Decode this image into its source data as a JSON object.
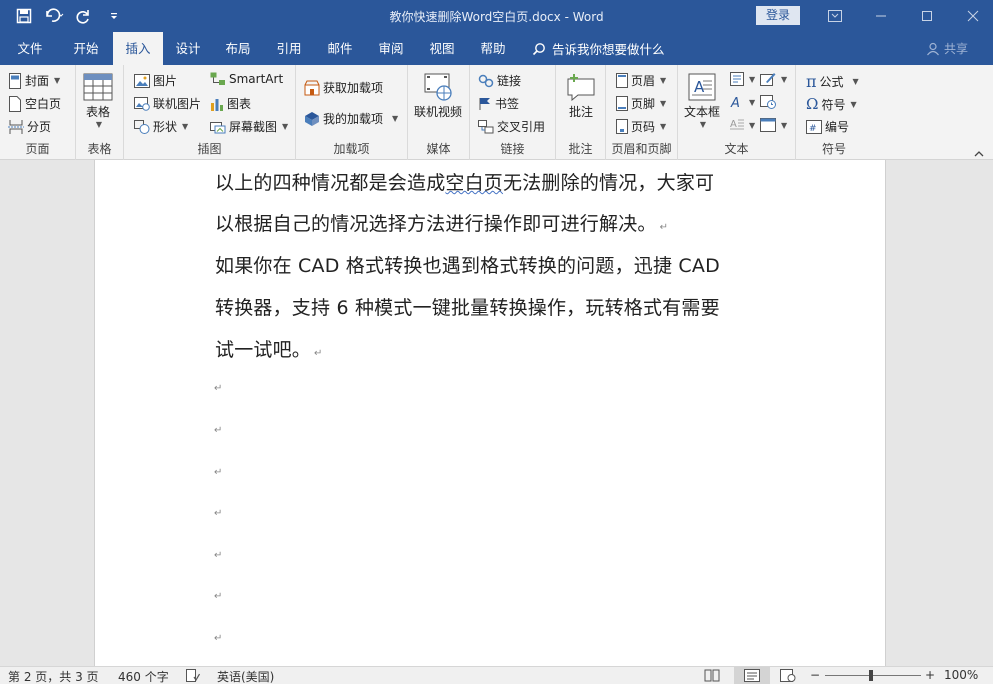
{
  "window": {
    "title": "教你快速删除Word空白页.docx  -  Word",
    "login_label": "登录"
  },
  "tabs": [
    {
      "label": "文件"
    },
    {
      "label": "开始"
    },
    {
      "label": "插入",
      "active": true
    },
    {
      "label": "设计"
    },
    {
      "label": "布局"
    },
    {
      "label": "引用"
    },
    {
      "label": "邮件"
    },
    {
      "label": "审阅"
    },
    {
      "label": "视图"
    },
    {
      "label": "帮助"
    }
  ],
  "tell_me": "告诉我你想要做什么",
  "account_label": "共享",
  "ribbon": {
    "pages": {
      "label": "页面",
      "cover": "封面",
      "blank": "空白页",
      "break": "分页"
    },
    "tables": {
      "label": "表格",
      "table": "表格"
    },
    "illustrations": {
      "label": "插图",
      "pictures": "图片",
      "online_pictures": "联机图片",
      "shapes": "形状",
      "smartart": "SmartArt",
      "chart": "图表",
      "screenshot": "屏幕截图"
    },
    "addins": {
      "label": "加载项",
      "get": "获取加载项",
      "my": "我的加载项"
    },
    "media": {
      "label": "媒体",
      "online_video": "联机视频"
    },
    "links": {
      "label": "链接",
      "link": "链接",
      "bookmark": "书签",
      "cross_ref": "交叉引用"
    },
    "comments": {
      "label": "批注",
      "comment": "批注"
    },
    "header_footer": {
      "label": "页眉和页脚",
      "header": "页眉",
      "footer": "页脚",
      "page_number": "页码"
    },
    "text": {
      "label": "文本",
      "textbox": "文本框"
    },
    "symbols": {
      "label": "符号",
      "equation": "公式",
      "symbol": "符号",
      "numbering": "编号"
    }
  },
  "document": {
    "line1a": "以上的四种情况都是会造成",
    "line1b": "空白页",
    "line1c": "无法删除的情况，大家可",
    "line2": "以根据自己的情况选择方法进行操作即可进行解决。",
    "line3": "如果你在 CAD 格式转换也遇到格式转换的问题，迅捷 CAD",
    "line4": "转换器，支持 6 种模式一键批量转换操作，玩转格式有需要",
    "line5": "试一试吧。",
    "para_mark": "↵"
  },
  "status": {
    "page": "第 2 页，共 3 页",
    "words": "460 个字",
    "language": "英语(美国)",
    "zoom": "100%"
  },
  "colors": {
    "accent": "#2b579a",
    "ribbon_bg": "#f3f3f3"
  }
}
